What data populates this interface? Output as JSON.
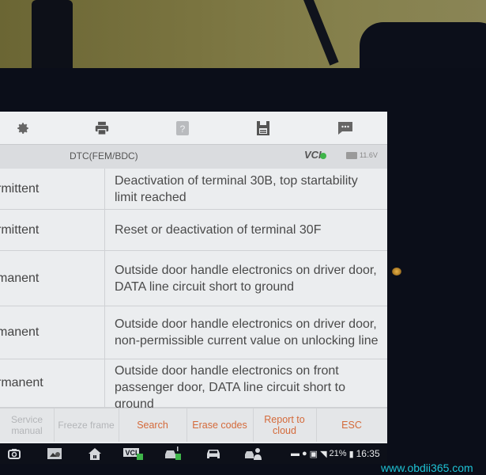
{
  "toolbar": {
    "icons": [
      "gear-icon",
      "printer-icon",
      "help-icon",
      "save-icon",
      "message-icon"
    ]
  },
  "header": {
    "title": "DTC(FEM/BDC)",
    "vci_label": "VCI",
    "battery_voltage": "11.6V"
  },
  "dtc_rows": [
    {
      "status": "rmittent",
      "description": "Deactivation of terminal 30B, top startability limit reached"
    },
    {
      "status": "rmittent",
      "description": "Reset or deactivation of terminal 30F"
    },
    {
      "status": "manent",
      "description": "Outside door handle electronics on driver door, DATA line circuit short to ground"
    },
    {
      "status": "manent",
      "description": "Outside door handle electronics on driver door, non-permissible current value on unlocking line"
    },
    {
      "status": "rmanent",
      "description": "Outside door handle electronics on front passenger door, DATA line circuit short to ground"
    }
  ],
  "actions": {
    "service_manual": "Service manual",
    "freeze_frame": "Freeze frame",
    "search": "Search",
    "erase_codes": "Erase codes",
    "report_to_cloud": "Report to cloud",
    "esc": "ESC"
  },
  "system_nav": {
    "icons": [
      "camera-icon",
      "screenshot-icon",
      "home-icon",
      "vci-status-icon",
      "vehicle-connect-icon",
      "car-icon",
      "remote-expert-icon"
    ]
  },
  "status_bar": {
    "battery_percent": "21%",
    "time": "16:35"
  },
  "watermark": "www.obdii365.com",
  "colors": {
    "accent": "#d46a3a",
    "disabled": "#b3b5b8",
    "vci_ok": "#3fb54a",
    "watermark": "#1ec3d6"
  }
}
